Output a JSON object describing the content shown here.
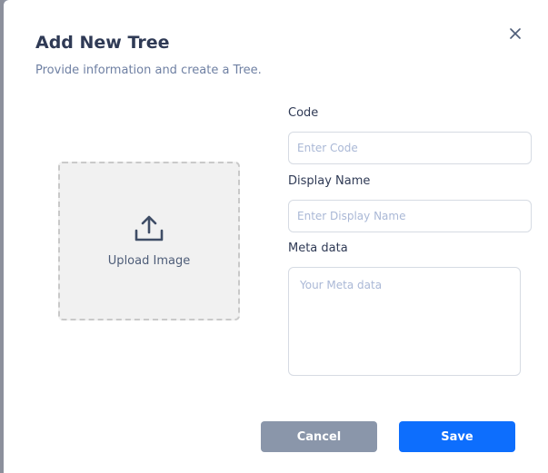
{
  "dialog": {
    "title": "Add New Tree",
    "subtitle": "Provide information and create a Tree.",
    "close_icon": "close-icon"
  },
  "upload": {
    "label": "Upload Image",
    "icon": "upload-icon"
  },
  "form": {
    "code_label": "Code",
    "code_placeholder": "Enter Code",
    "code_value": "",
    "display_name_label": "Display Name",
    "display_name_placeholder": "Enter Display Name",
    "display_name_value": "",
    "meta_label": "Meta data",
    "meta_placeholder": "Your Meta data",
    "meta_value": ""
  },
  "actions": {
    "cancel_label": "Cancel",
    "save_label": "Save"
  },
  "colors": {
    "primary": "#0d6efd",
    "cancel": "#8a96aa",
    "title": "#2f3a55",
    "subtitle": "#6f80a3"
  }
}
